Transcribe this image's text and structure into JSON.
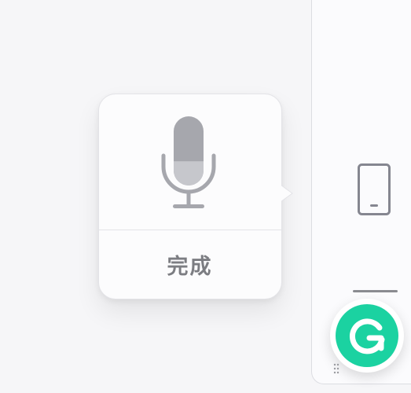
{
  "popover": {
    "done_label": "完成",
    "mic_icon": "microphone-icon",
    "mic_level": 0.35
  },
  "side_panel": {
    "device_icon": "tablet-icon"
  },
  "extension": {
    "icon": "grammarly-g-icon",
    "brand_color": "#1bd2a1"
  },
  "colors": {
    "mic": "#a6a7ad",
    "mic_fill": "#c6c7cc",
    "done_text": "#7c7d82",
    "background": "#f6f6f8"
  }
}
